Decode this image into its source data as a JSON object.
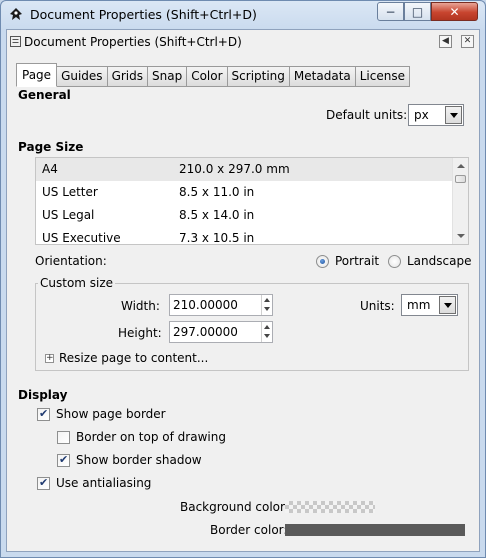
{
  "window": {
    "title": "Document Properties (Shift+Ctrl+D)",
    "minimize_symbol": "−",
    "maximize_symbol": "□",
    "close_symbol": "✕"
  },
  "dock": {
    "title": "Document Properties (Shift+Ctrl+D)",
    "iconify_symbol": "◀",
    "close_symbol": "✕"
  },
  "tabs": [
    "Page",
    "Guides",
    "Grids",
    "Snap",
    "Color",
    "Scripting",
    "Metadata",
    "License"
  ],
  "active_tab": "Page",
  "general": {
    "heading": "General",
    "default_units_label": "Default units:",
    "default_units_value": "px"
  },
  "page_size": {
    "heading": "Page Size",
    "rows": [
      {
        "name": "A4",
        "size": "210.0 x 297.0 mm"
      },
      {
        "name": "US Letter",
        "size": "8.5 x 11.0 in"
      },
      {
        "name": "US Legal",
        "size": "8.5 x 14.0 in"
      },
      {
        "name": "US Executive",
        "size": "7.3 x 10.5 in"
      }
    ],
    "selected_row": "A4",
    "orientation_label": "Orientation:",
    "portrait_label": "Portrait",
    "landscape_label": "Landscape",
    "orientation_value": "Portrait"
  },
  "custom_size": {
    "legend": "Custom size",
    "width_label": "Width:",
    "width_value": "210.00000",
    "height_label": "Height:",
    "height_value": "297.00000",
    "units_label": "Units:",
    "units_value": "mm",
    "resize_label": "Resize page to content...",
    "expander_symbol": "+"
  },
  "display": {
    "heading": "Display",
    "show_page_border": {
      "label": "Show page border",
      "checked": true
    },
    "border_on_top": {
      "label": "Border on top of drawing",
      "checked": false
    },
    "show_border_shadow": {
      "label": "Show border shadow",
      "checked": true
    },
    "use_antialiasing": {
      "label": "Use antialiasing",
      "checked": true
    },
    "background_color_label": "Background color:",
    "border_color_label": "Border color:",
    "border_color": "#5a5a5a"
  },
  "colors": {
    "title_bar": "#c9daee",
    "close_button": "#c8452f",
    "selected_row": "#e8e8e8"
  }
}
